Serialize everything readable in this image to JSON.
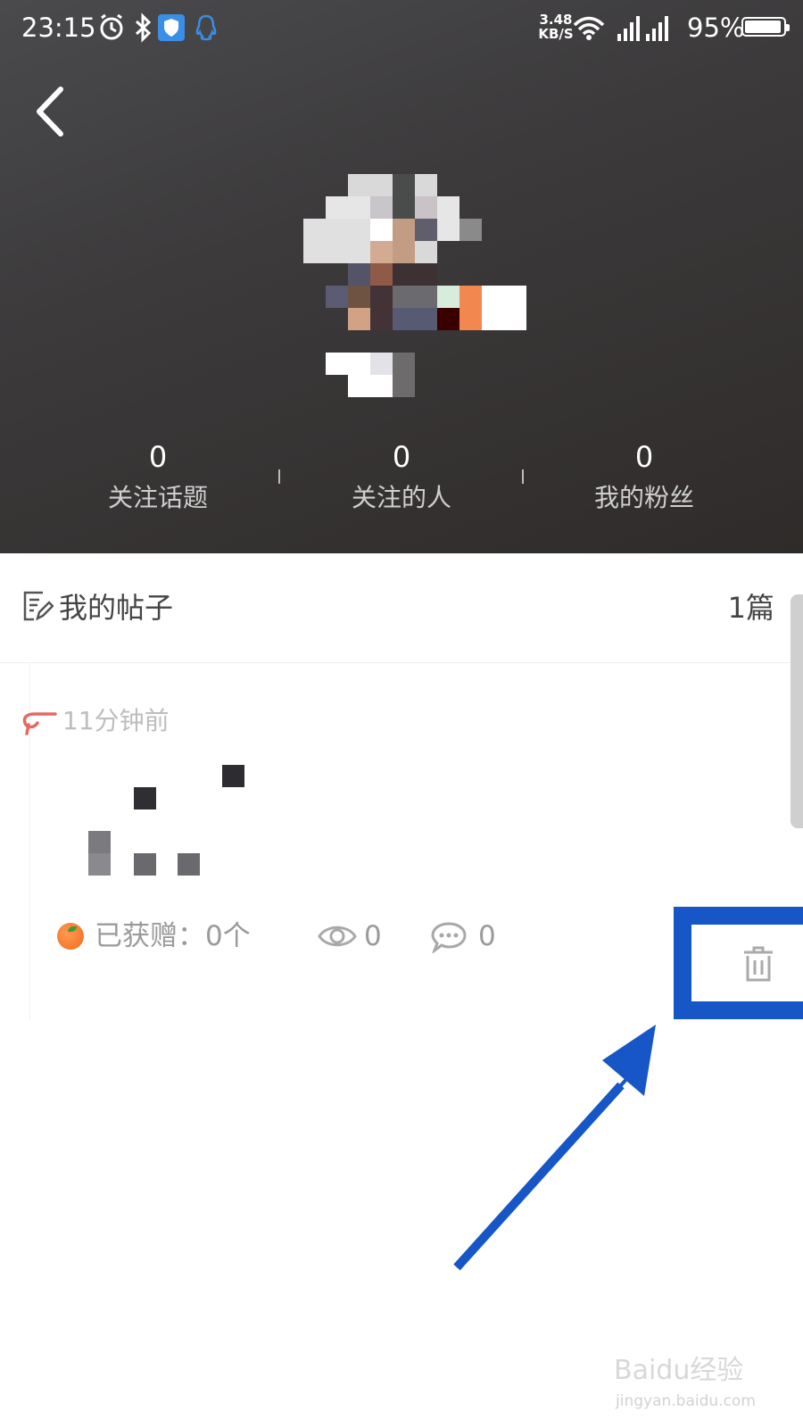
{
  "status_bar": {
    "time": "23:15",
    "speed_value": "3.48",
    "speed_unit": "KB/S",
    "battery_percent": "95%",
    "battery_level": 0.95,
    "icons": [
      "alarm-icon",
      "bluetooth-icon",
      "shield-icon",
      "qq-icon",
      "wifi-icon",
      "signal-icon",
      "signal-4g-icon",
      "battery-icon"
    ]
  },
  "header": {
    "back_icon": "chevron-left-icon",
    "stats": [
      {
        "value": "0",
        "label": "关注话题"
      },
      {
        "value": "0",
        "label": "关注的人"
      },
      {
        "value": "0",
        "label": "我的粉丝"
      }
    ]
  },
  "posts": {
    "title": "我的帖子",
    "count": "1篇",
    "items": [
      {
        "time": "11分钟前",
        "gift_label": "已获赠：0个",
        "views": "0",
        "comments": "0",
        "icons": [
          "orange-icon",
          "eye-icon",
          "comment-icon",
          "trash-icon"
        ]
      }
    ]
  },
  "annotation": {
    "highlight_color": "#1656c6"
  },
  "watermark": {
    "brand": "Baidu经验",
    "url": "jingyan.baidu.com"
  }
}
